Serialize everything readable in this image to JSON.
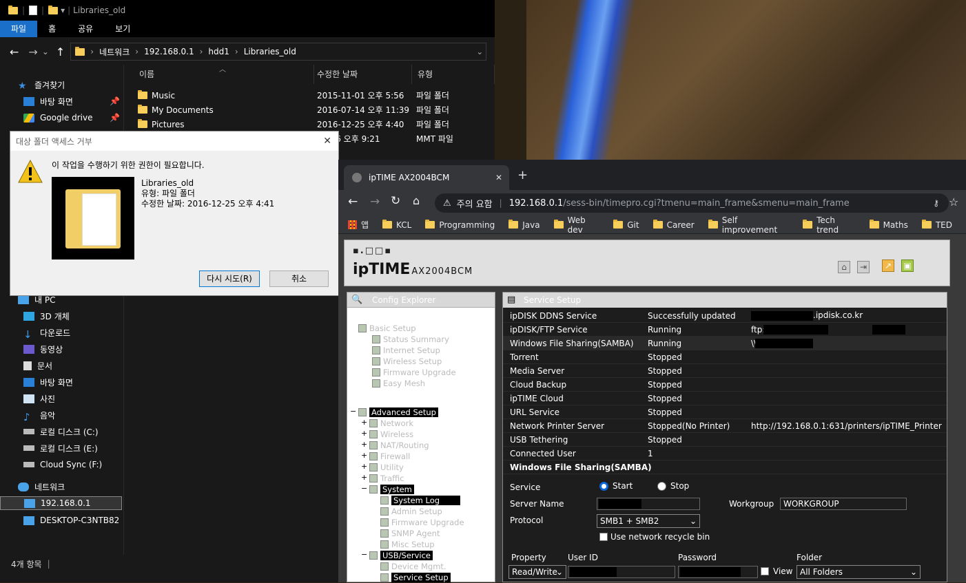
{
  "explorer": {
    "title_path": "Libraries_old",
    "ribbon": [
      "파일",
      "홈",
      "공유",
      "보기"
    ],
    "crumbs": [
      "네트워크",
      "192.168.0.1",
      "hdd1",
      "Libraries_old"
    ],
    "columns": [
      "이름",
      "수정한 날짜",
      "유형"
    ],
    "files": [
      {
        "name": "Music",
        "date": "2015-11-01 오후 5:56",
        "type": "파일 폴더"
      },
      {
        "name": "My Documents",
        "date": "2016-07-14 오후 11:39",
        "type": "파일 폴더"
      },
      {
        "name": "Pictures",
        "date": "2016-12-25 오후 4:40",
        "type": "파일 폴더"
      },
      {
        "name": "",
        "date": "12-16 오후 9:21",
        "type": "MMT 파일"
      }
    ],
    "nav": {
      "quick": "즐겨찾기",
      "pinned": [
        "바탕 화면",
        "Google drive"
      ],
      "pc": "내 PC",
      "pc_items": [
        "3D 개체",
        "다운로드",
        "동영상",
        "문서",
        "바탕 화면",
        "사진",
        "음악",
        "로컬 디스크 (C:)",
        "로컬 디스크 (E:)",
        "Cloud Sync (F:)"
      ],
      "network": "네트워크",
      "net_items": [
        "192.168.0.1",
        "DESKTOP-C3NTB82"
      ]
    },
    "status": "4개 항목"
  },
  "dialog": {
    "title": "대상 폴더 액세스 거부",
    "message": "이 작업을 수행하기 위한 권한이 필요합니다.",
    "item_name": "Libraries_old",
    "item_type": "유형: 파일 폴더",
    "item_date": "수정한 날짜: 2016-12-25 오후 4:41",
    "retry": "다시 시도(R)",
    "cancel": "취소"
  },
  "browser": {
    "tab_title": "ipTIME AX2004BCM",
    "warning": "주의 요함",
    "url_host": "192.168.0.1",
    "url_path": "/sess-bin/timepro.cgi?tmenu=main_frame&smenu=main_frame",
    "bookmarks": [
      "앱",
      "KCL",
      "Programming",
      "Java",
      "Web dev",
      "Git",
      "Career",
      "Self improvement",
      "Tech trend",
      "Maths",
      "TED"
    ]
  },
  "router": {
    "brand": "ipTIME",
    "model": "AX2004BCM",
    "config_title": "Config Explorer",
    "service_title": "Service Setup",
    "tree": [
      {
        "label": "Basic Setup",
        "on": false
      },
      {
        "label": "Status Summary",
        "on": false
      },
      {
        "label": "Internet Setup",
        "on": false
      },
      {
        "label": "Wireless Setup",
        "on": false
      },
      {
        "label": "Firmware Upgrade",
        "on": false
      },
      {
        "label": "Easy Mesh",
        "on": false
      },
      {
        "label": "Advanced Setup",
        "on": true
      },
      {
        "label": "Network",
        "on": false
      },
      {
        "label": "Wireless",
        "on": false
      },
      {
        "label": "NAT/Routing",
        "on": false
      },
      {
        "label": "Firewall",
        "on": false
      },
      {
        "label": "Utility",
        "on": false
      },
      {
        "label": "Traffic",
        "on": false
      },
      {
        "label": "System",
        "on": true
      },
      {
        "label": "System Log",
        "on": true
      },
      {
        "label": "Admin Setup",
        "on": false
      },
      {
        "label": "Firmware Upgrade",
        "on": false
      },
      {
        "label": "SNMP Agent",
        "on": false
      },
      {
        "label": "Misc Setup",
        "on": false
      },
      {
        "label": "USB/Service",
        "on": true
      },
      {
        "label": "Device Mgmt.",
        "on": false
      },
      {
        "label": "Service Setup",
        "on": true
      }
    ],
    "services": [
      {
        "name": "ipDISK DDNS Service",
        "status": "Successfully updated",
        "info": ".ipdisk.co.kr"
      },
      {
        "name": "ipDISK/FTP Service",
        "status": "Running",
        "info": "ftp:/ pdisk.co.kr:"
      },
      {
        "name": "Windows File Sharing(SAMBA)",
        "status": "Running",
        "info": "\\\\"
      },
      {
        "name": "Torrent",
        "status": "Stopped",
        "info": ""
      },
      {
        "name": "Media Server",
        "status": "Stopped",
        "info": ""
      },
      {
        "name": "Cloud Backup",
        "status": "Stopped",
        "info": ""
      },
      {
        "name": "ipTIME Cloud",
        "status": "Stopped",
        "info": ""
      },
      {
        "name": "URL Service",
        "status": "Stopped",
        "info": ""
      },
      {
        "name": "Network Printer Server",
        "status": "Stopped(No Printer)",
        "info": "http://192.168.0.1:631/printers/ipTIME_Printer"
      },
      {
        "name": "USB Tethering",
        "status": "Stopped",
        "info": ""
      },
      {
        "name": "Connected User",
        "status": "1",
        "info": ""
      }
    ],
    "samba": {
      "heading": "Windows File Sharing(SAMBA)",
      "service_label": "Service",
      "start": "Start",
      "stop": "Stop",
      "server_name_label": "Server Name",
      "workgroup_label": "Workgroup",
      "workgroup": "WORKGROUP",
      "protocol_label": "Protocol",
      "protocol": "SMB1 + SMB2",
      "recycle": "Use network recycle bin",
      "cols": [
        "Property",
        "User ID",
        "Password",
        "Folder"
      ],
      "property": "Read/Write",
      "view": "View",
      "folder": "All Folders"
    }
  }
}
